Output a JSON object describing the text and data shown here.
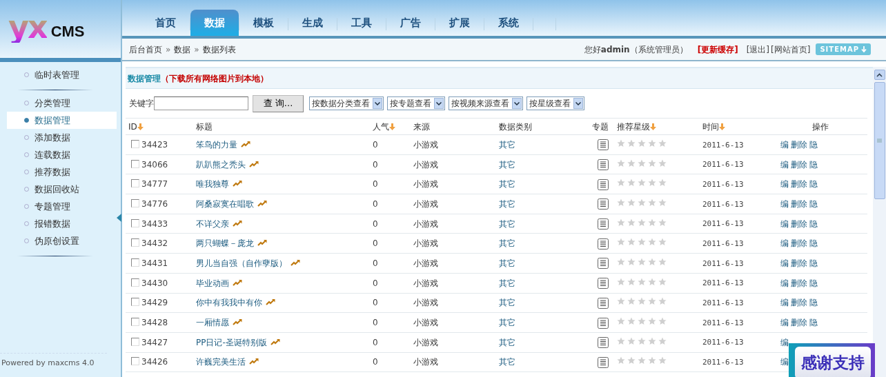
{
  "logo": {
    "mark": "yx",
    "text": "CMS"
  },
  "nav": [
    {
      "label": "首页",
      "selected": false
    },
    {
      "label": "数据",
      "selected": true
    },
    {
      "label": "模板",
      "selected": false
    },
    {
      "label": "生成",
      "selected": false
    },
    {
      "label": "工具",
      "selected": false
    },
    {
      "label": "广告",
      "selected": false
    },
    {
      "label": "扩展",
      "selected": false
    },
    {
      "label": "系统",
      "selected": false
    }
  ],
  "breadcrumb": [
    "后台首页",
    "»",
    "数据",
    "»",
    "数据列表"
  ],
  "user_bar": {
    "greeting": "您好**admin**（系统管理员）",
    "refresh_cache": "[更新缓存]",
    "links": [
      "[退出]",
      "[网站首页]"
    ],
    "sitemap": "SITEMAP"
  },
  "sidebar": {
    "groups": [
      [
        {
          "label": "临时表管理",
          "selected": false
        }
      ],
      [
        {
          "label": "分类管理",
          "selected": false
        },
        {
          "label": "数据管理",
          "selected": true
        },
        {
          "label": "添加数据",
          "selected": false
        },
        {
          "label": "连载数据",
          "selected": false
        },
        {
          "label": "推荐数据",
          "selected": false
        },
        {
          "label": "数据回收站",
          "selected": false
        },
        {
          "label": "专题管理",
          "selected": false
        },
        {
          "label": "报错数据",
          "selected": false
        },
        {
          "label": "伪原创设置",
          "selected": false
        }
      ]
    ],
    "footer": "Powered by maxcms 4.0"
  },
  "panel": {
    "title": "数据管理",
    "link": "（下载所有网络图片到本地）"
  },
  "filters": {
    "keyword_label": "关键字",
    "search_button": "查 询...",
    "selects": [
      "按数据分类查看",
      "按专题查看",
      "按视频来源查看",
      "按星级查看"
    ]
  },
  "table": {
    "columns": [
      {
        "label": "ID",
        "sortable": true
      },
      {
        "label": "标题",
        "sortable": false
      },
      {
        "label": "人气",
        "sortable": true
      },
      {
        "label": "来源",
        "sortable": false
      },
      {
        "label": "数据类别",
        "sortable": false
      },
      {
        "label": "专题",
        "sortable": false
      },
      {
        "label": "推荐星级",
        "sortable": true
      },
      {
        "label": "时间",
        "sortable": true
      },
      {
        "label": "操作",
        "sortable": false
      }
    ],
    "rows": [
      {
        "checked": false,
        "id": "34423",
        "title": "笨鸟的力量",
        "hits": "0",
        "source": "小游戏",
        "category": "其它",
        "stars": 0,
        "time": "2011-6-13",
        "actions": [
          "编",
          "删除",
          "隐"
        ]
      },
      {
        "checked": false,
        "id": "34066",
        "title": "趴趴熊之秃头",
        "hits": "0",
        "source": "小游戏",
        "category": "其它",
        "stars": 0,
        "time": "2011-6-13",
        "actions": [
          "编",
          "删除",
          "隐"
        ]
      },
      {
        "checked": false,
        "id": "34777",
        "title": "唯我独尊",
        "hits": "0",
        "source": "小游戏",
        "category": "其它",
        "stars": 0,
        "time": "2011-6-13",
        "actions": [
          "编",
          "删除",
          "隐"
        ]
      },
      {
        "checked": false,
        "id": "34776",
        "title": "阿桑寂寞在唱歌",
        "hits": "0",
        "source": "小游戏",
        "category": "其它",
        "stars": 0,
        "time": "2011-6-13",
        "actions": [
          "编",
          "删除",
          "隐"
        ]
      },
      {
        "checked": false,
        "id": "34433",
        "title": "不详父亲",
        "hits": "0",
        "source": "小游戏",
        "category": "其它",
        "stars": 0,
        "time": "2011-6-13",
        "actions": [
          "编",
          "删除",
          "隐"
        ]
      },
      {
        "checked": false,
        "id": "34432",
        "title": "两只蝴蝶－庞龙",
        "hits": "0",
        "source": "小游戏",
        "category": "其它",
        "stars": 0,
        "time": "2011-6-13",
        "actions": [
          "编",
          "删除",
          "隐"
        ]
      },
      {
        "checked": false,
        "id": "34431",
        "title": "男儿当自强（自作孽版）",
        "hits": "0",
        "source": "小游戏",
        "category": "其它",
        "stars": 0,
        "time": "2011-6-13",
        "actions": [
          "编",
          "删除",
          "隐"
        ]
      },
      {
        "checked": false,
        "id": "34430",
        "title": "毕业动画",
        "hits": "0",
        "source": "小游戏",
        "category": "其它",
        "stars": 0,
        "time": "2011-6-13",
        "actions": [
          "编",
          "删除",
          "隐"
        ]
      },
      {
        "checked": false,
        "id": "34429",
        "title": "你中有我我中有你",
        "hits": "0",
        "source": "小游戏",
        "category": "其它",
        "stars": 0,
        "time": "2011-6-13",
        "actions": [
          "编",
          "删除",
          "隐"
        ]
      },
      {
        "checked": false,
        "id": "34428",
        "title": "一厢情愿",
        "hits": "0",
        "source": "小游戏",
        "category": "其它",
        "stars": 0,
        "time": "2011-6-13",
        "actions": [
          "编",
          "删除",
          "隐"
        ]
      },
      {
        "checked": false,
        "id": "34427",
        "title": "PP日记-圣诞特别版",
        "hits": "0",
        "source": "小游戏",
        "category": "其它",
        "stars": 0,
        "time": "2011-6-13",
        "actions": [
          "编"
        ]
      },
      {
        "checked": false,
        "id": "34426",
        "title": "许巍完美生活",
        "hits": "0",
        "source": "小游戏",
        "category": "其它",
        "stars": 0,
        "time": "2011-6-13",
        "actions": [
          "编"
        ]
      }
    ]
  },
  "thanks_badge": "感谢支持"
}
